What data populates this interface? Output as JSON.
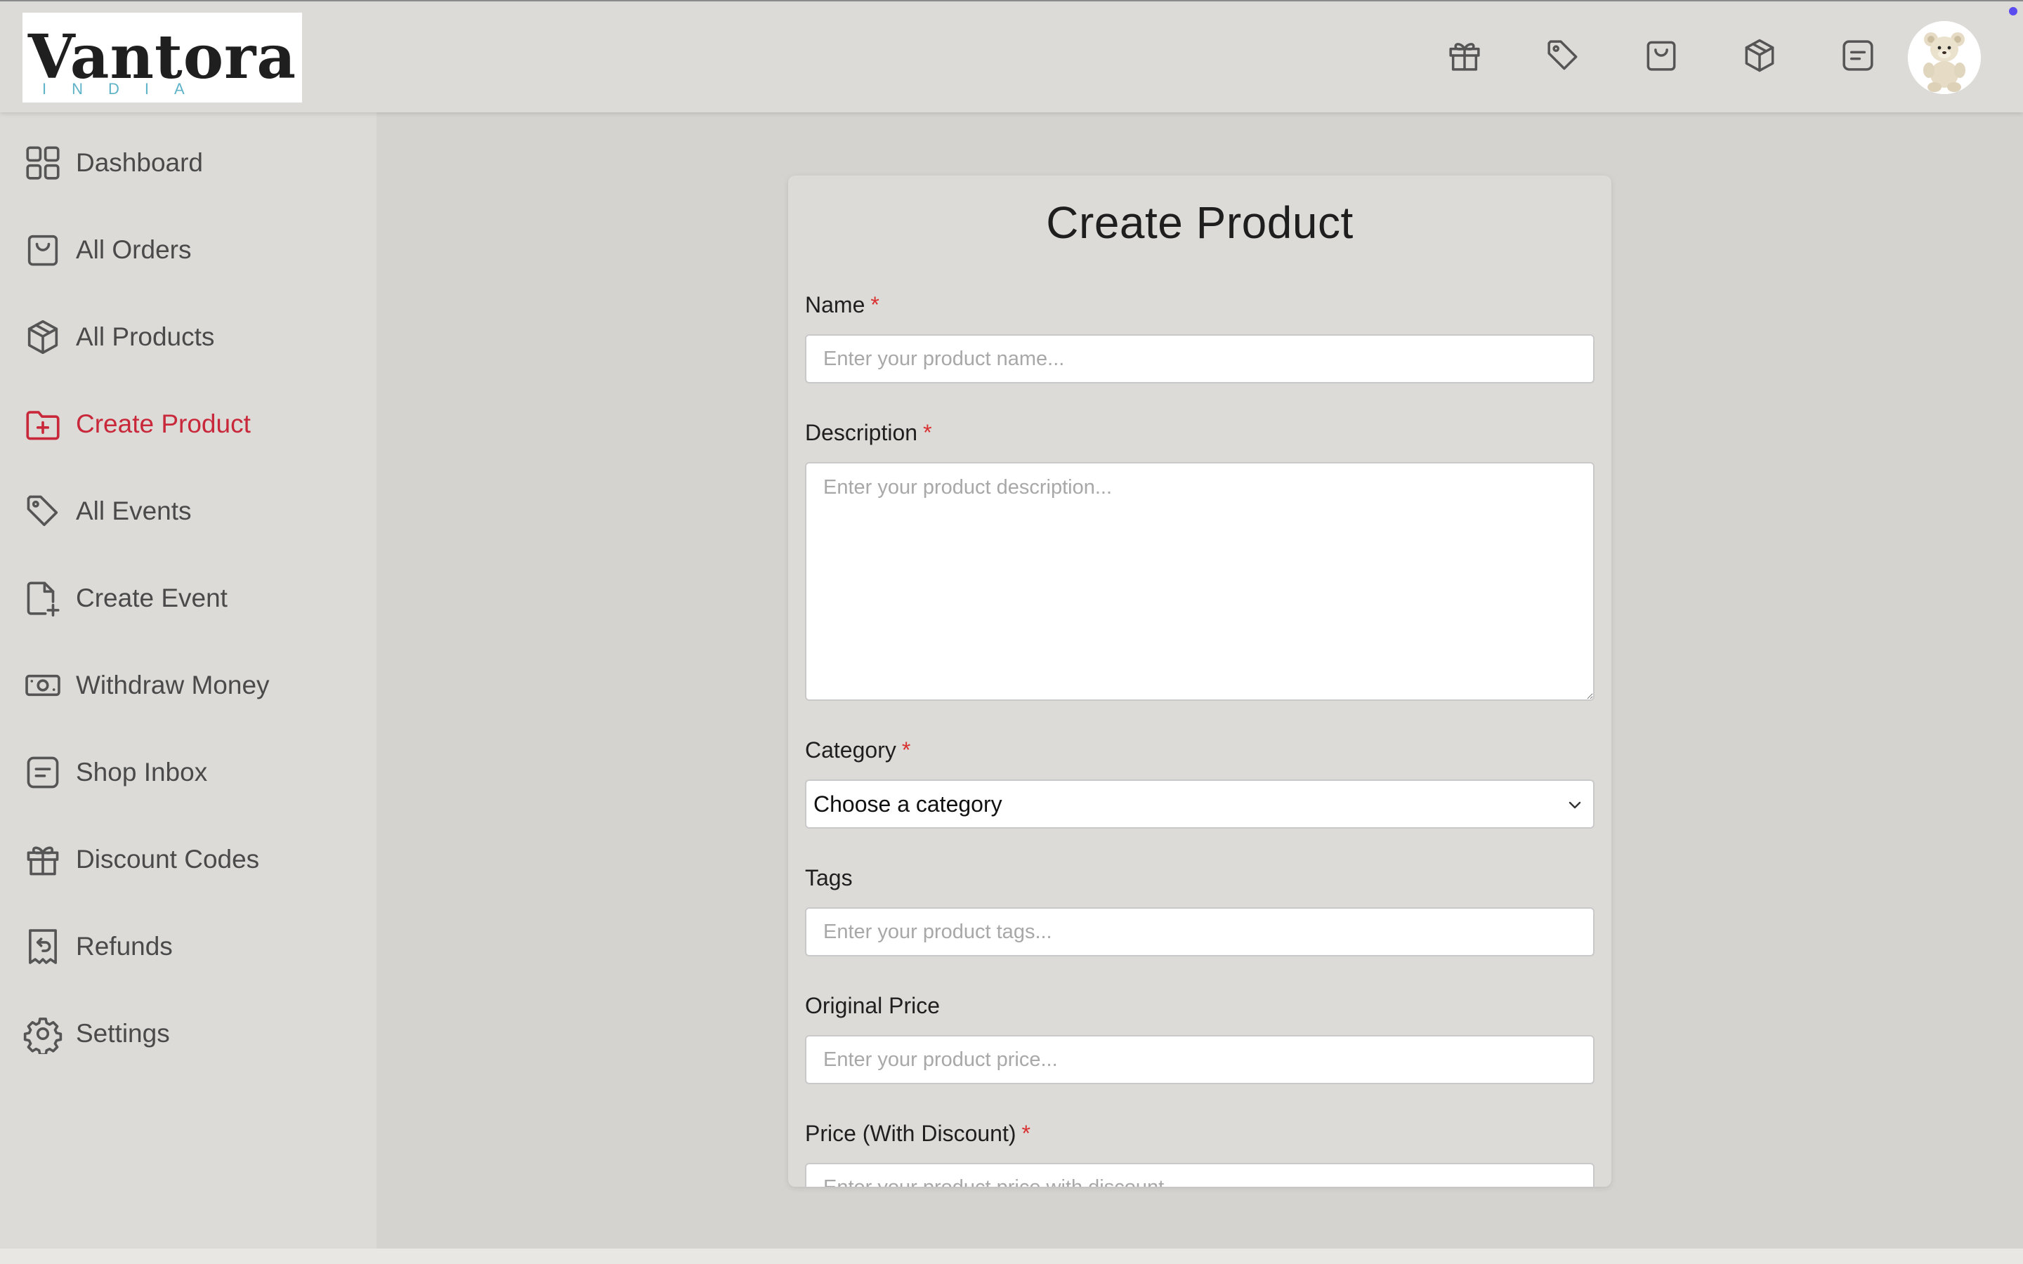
{
  "header": {
    "logo_word": "Vantora",
    "logo_sub": "INDIA",
    "icons": [
      "gift-icon",
      "tag-icon",
      "shopping-bag-icon",
      "package-icon",
      "message-icon"
    ]
  },
  "sidebar": {
    "items": [
      {
        "label": "Dashboard",
        "icon": "grid-icon"
      },
      {
        "label": "All Orders",
        "icon": "shopping-bag-icon"
      },
      {
        "label": "All Products",
        "icon": "package-icon"
      },
      {
        "label": "Create Product",
        "icon": "folder-plus-icon",
        "active": true
      },
      {
        "label": "All Events",
        "icon": "tag-icon"
      },
      {
        "label": "Create Event",
        "icon": "file-plus-icon"
      },
      {
        "label": "Withdraw Money",
        "icon": "cash-icon"
      },
      {
        "label": "Shop Inbox",
        "icon": "message-icon"
      },
      {
        "label": "Discount Codes",
        "icon": "gift-icon"
      },
      {
        "label": "Refunds",
        "icon": "receipt-refund-icon"
      },
      {
        "label": "Settings",
        "icon": "gear-icon"
      }
    ]
  },
  "form": {
    "title": "Create Product",
    "required_mark": "*",
    "name": {
      "label": "Name",
      "placeholder": "Enter your product name..."
    },
    "description": {
      "label": "Description",
      "placeholder": "Enter your product description..."
    },
    "category": {
      "label": "Category",
      "selected": "Choose a category"
    },
    "tags": {
      "label": "Tags",
      "placeholder": "Enter your product tags..."
    },
    "original_price": {
      "label": "Original Price",
      "placeholder": "Enter your product price..."
    },
    "discount_price": {
      "label": "Price (With Discount)",
      "placeholder": "Enter your product price with discount..."
    }
  },
  "colors": {
    "accent_active": "#c8283a",
    "required": "#d93030",
    "notification_dot": "#5b4cf0"
  }
}
